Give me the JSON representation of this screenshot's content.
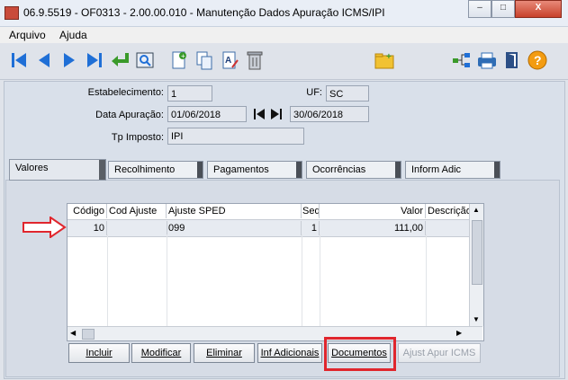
{
  "window": {
    "title": "06.9.5519 - OF0313 - 2.00.00.010 - Manutenção Dados Apuração ICMS/IPI",
    "controls": {
      "minimize": "–",
      "maximize": "□",
      "close": "X"
    }
  },
  "menu": {
    "items": [
      "Arquivo",
      "Ajuda"
    ]
  },
  "toolbar": {
    "icons": [
      "first-record-icon",
      "prev-record-icon",
      "next-record-icon",
      "last-record-icon",
      "return-arrow-icon",
      "zoom-icon",
      "new-document-icon",
      "copy-icon",
      "edit-icon",
      "trash-icon",
      "folder-add-icon",
      "tree-icon",
      "printer-icon",
      "exit-door-icon",
      "help-icon"
    ]
  },
  "form": {
    "estabelecimento": {
      "label": "Estabelecimento:",
      "value": "1"
    },
    "uf": {
      "label": "UF:",
      "value": "SC"
    },
    "data_apuracao": {
      "label": "Data Apuração:",
      "start": "01/06/2018",
      "end": "30/06/2018"
    },
    "tp_imposto": {
      "label": "Tp Imposto:",
      "value": "IPI"
    }
  },
  "tabs": [
    "Valores",
    "Recolhimento",
    "Pagamentos",
    "Ocorrências",
    "Inform Adic"
  ],
  "grid": {
    "headers": [
      "Código",
      "Cod Ajuste",
      "Ajuste SPED",
      "Seq",
      "Valor",
      "Descrição"
    ],
    "rows": [
      {
        "codigo": "10",
        "cod_ajuste": "",
        "ajuste_sped": "099",
        "seq": "1",
        "valor": "111,00",
        "descricao": ""
      }
    ]
  },
  "buttons": {
    "incluir": "Incluir",
    "modificar": "Modificar",
    "eliminar": "Eliminar",
    "inf_adicionais": "Inf Adicionais",
    "documentos": "Documentos",
    "ajust_apur_icms": "Ajust Apur ICMS"
  },
  "colors": {
    "highlight": "#e0262d",
    "arrow": "#e0262d"
  }
}
